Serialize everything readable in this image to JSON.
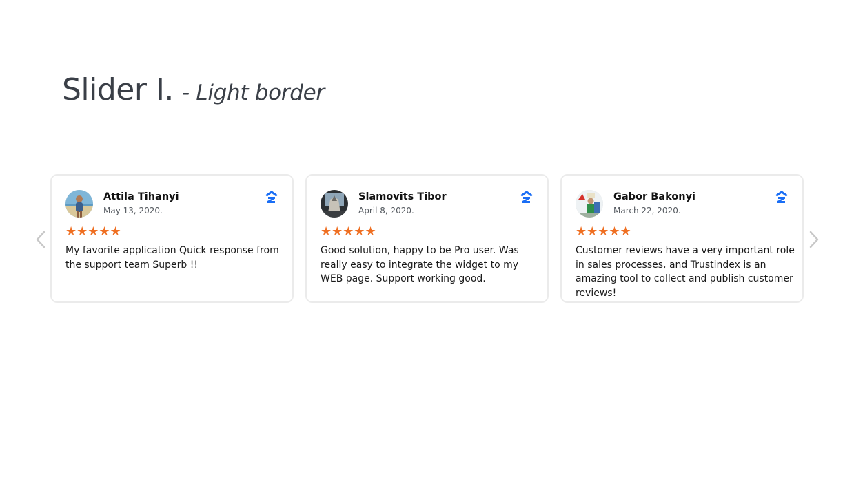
{
  "heading": {
    "main": "Slider I.",
    "sub": "- Light border"
  },
  "colors": {
    "star": "#ef6f22",
    "platform": "#1a6ef5",
    "border": "#ebebeb",
    "arrow": "#c8c8c8"
  },
  "slider": {
    "prev_icon": "chevron-left-icon",
    "next_icon": "chevron-right-icon",
    "reviews": [
      {
        "name": "Attila Tihanyi",
        "date": "May 13, 2020.",
        "rating": 5,
        "stars": "★★★★★",
        "text": "My favorite application Quick response from the support team Superb !!",
        "platform_icon": "zillow-icon"
      },
      {
        "name": "Slamovits Tibor",
        "date": "April 8, 2020.",
        "rating": 5,
        "stars": "★★★★★",
        "text": "Good solution, happy to be Pro user. Was really easy to integrate the widget to my WEB page. Support working good.",
        "platform_icon": "zillow-icon"
      },
      {
        "name": "Gabor Bakonyi",
        "date": "March 22, 2020.",
        "rating": 5,
        "stars": "★★★★★",
        "text": "Customer reviews have a very important role in sales processes, and Trustindex is an amazing tool to collect and publish customer reviews!",
        "platform_icon": "zillow-icon"
      }
    ]
  }
}
